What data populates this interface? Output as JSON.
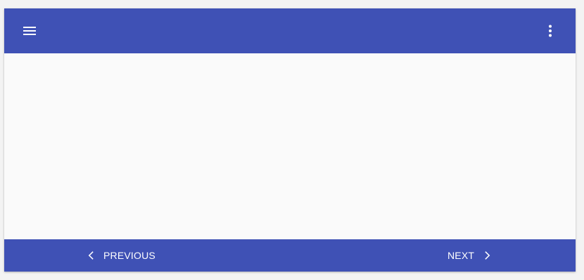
{
  "toolbar": {
    "menu_icon": "menu-icon",
    "more_icon": "more-vert-icon"
  },
  "navigation": {
    "previous_label": "PREVIOUS",
    "next_label": "NEXT",
    "previous_icon": "chevron-left-icon",
    "next_icon": "chevron-right-icon"
  },
  "colors": {
    "primary": "#3f51b5",
    "content_background": "#fafafa",
    "text_on_primary": "#ffffff"
  }
}
